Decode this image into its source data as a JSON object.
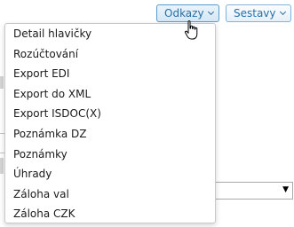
{
  "toolbar": {
    "links_label": "Odkazy",
    "reports_label": "Sestavy"
  },
  "links_menu": {
    "items": [
      "Detail hlavičky",
      "Rozúčtování",
      "Export EDI",
      "Export do XML",
      "Export ISDOC(X)",
      "Poznámka DZ",
      "Poznámky",
      "Úhrady",
      "Záloha val",
      "Záloha CZK"
    ]
  },
  "background_select": {
    "value": ""
  },
  "icons": {
    "dropdown_chevron": "chevron-down-icon",
    "cursor": "hand-pointer-icon"
  },
  "colors": {
    "button_text": "#2a6ea6",
    "button_border": "#7fb3d8"
  }
}
